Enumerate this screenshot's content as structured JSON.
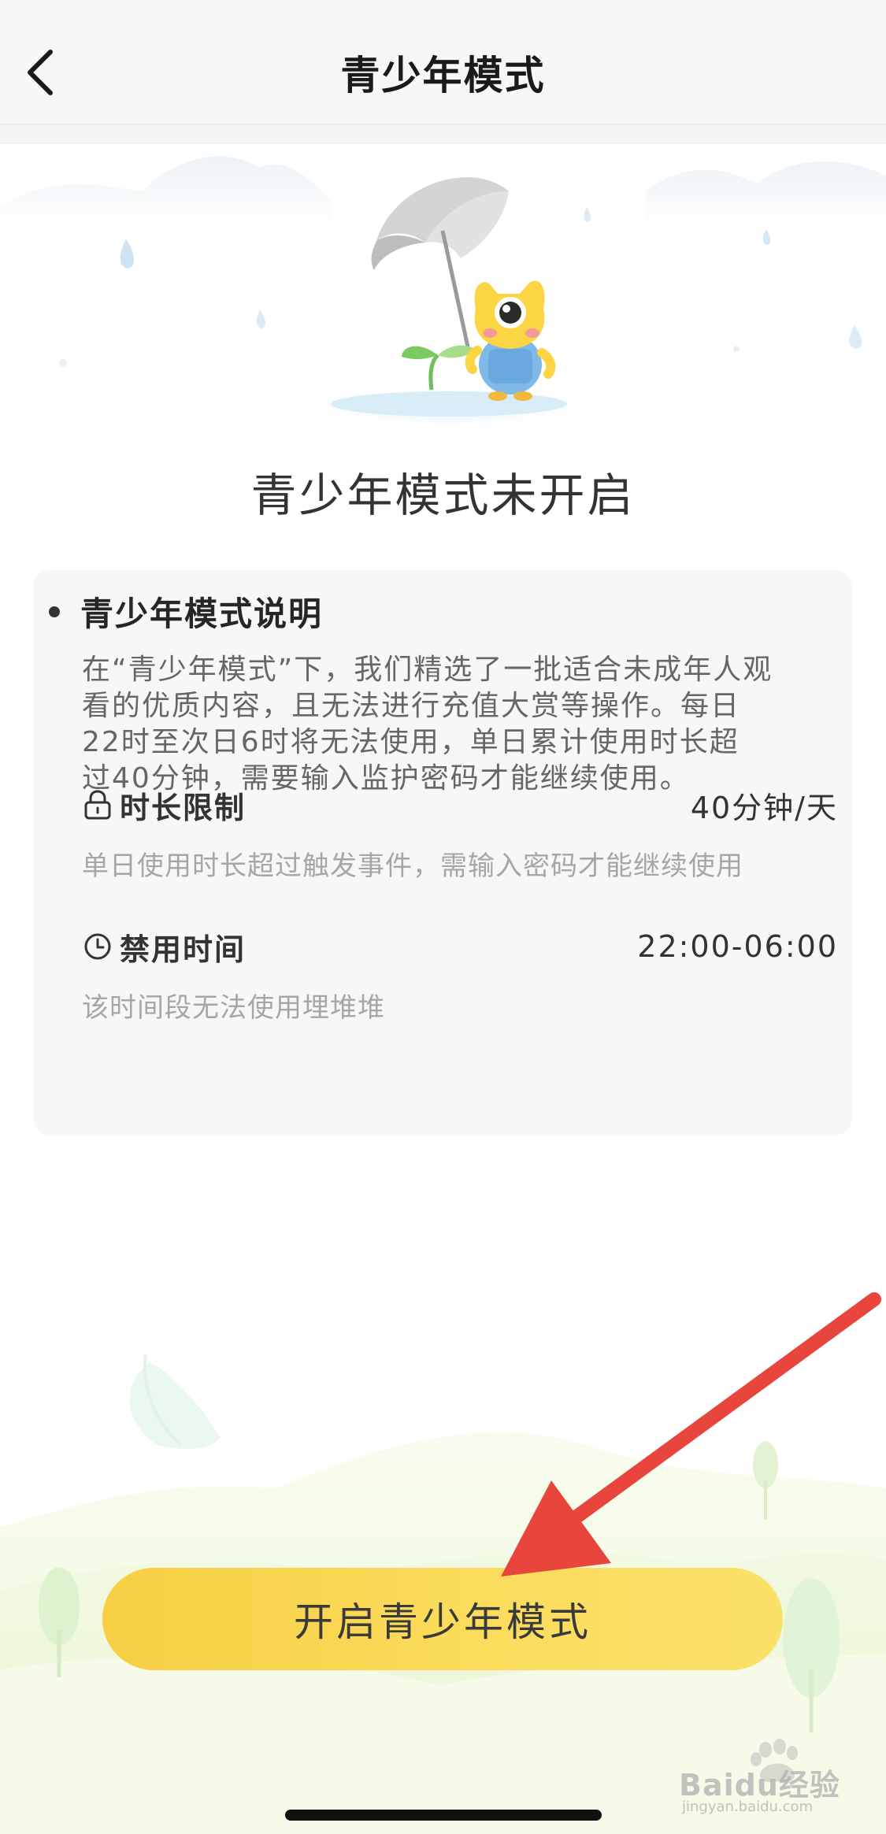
{
  "header": {
    "title": "青少年模式"
  },
  "status": {
    "title": "青少年模式未开启"
  },
  "card": {
    "heading": "青少年模式说明",
    "description_lines": [
      "在“青少年模式”下，我们精选了一批适合未成年人观",
      "看的优质内容，且无法进行充值大赏等操作。每日",
      "22时至次日6时将无法使用，单日累计使用时长超",
      "过40分钟，需要输入监护密码才能继续使用。"
    ],
    "rules": [
      {
        "icon": "lock-icon",
        "label": "时长限制",
        "value": "40分钟/天",
        "note": "单日使用时长超过触发事件，需输入密码才能继续使用"
      },
      {
        "icon": "clock-icon",
        "label": "禁用时间",
        "value": "22:00-06:00",
        "note": "该时间段无法使用埋堆堆"
      }
    ]
  },
  "cta": {
    "label": "开启青少年模式"
  },
  "watermark": {
    "brand": "Baidu经验",
    "url": "jingyan.baidu.com"
  },
  "colors": {
    "button_yellow": "#f9d54f",
    "annotation_arrow": "#e8453c",
    "card_bg": "#f7f7f7"
  }
}
